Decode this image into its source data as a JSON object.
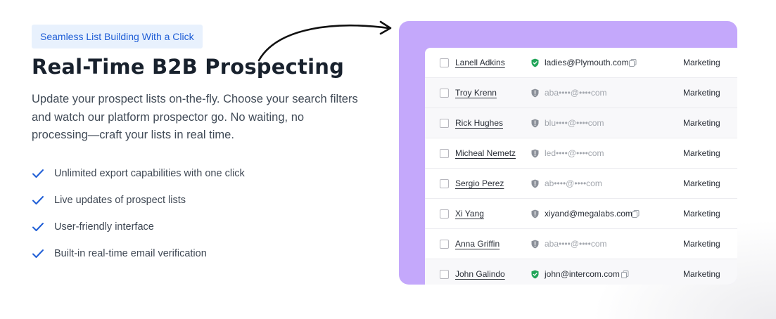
{
  "badge": "Seamless List Building With a Click",
  "headline": "Real-Time B2B Prospecting",
  "description": "Update your prospect lists on-the-fly. Choose your search filters and watch our platform prospector go. No waiting, no processing—craft your lists in real time.",
  "features": [
    "Unlimited export capabilities with one click",
    "Live updates of prospect lists",
    "User-friendly interface",
    "Built-in real-time email verification"
  ],
  "colors": {
    "accent": "#1f5ed6",
    "panel": "#c4a8fb",
    "verified": "#22a559",
    "unverified": "#8a8f98"
  },
  "prospects": [
    {
      "name": "Lanell Adkins",
      "email": "ladies@Plymouth.com",
      "verified": true,
      "department": "Marketing"
    },
    {
      "name": "Troy Krenn",
      "email": "aba••••@••••com",
      "verified": false,
      "department": "Marketing"
    },
    {
      "name": "Rick Hughes",
      "email": "blu••••@••••com",
      "verified": false,
      "department": "Marketing"
    },
    {
      "name": "Micheal Nemetz",
      "email": "led••••@••••com",
      "verified": false,
      "department": "Marketing"
    },
    {
      "name": "Sergio Perez",
      "email": "ab••••@••••com",
      "verified": false,
      "department": "Marketing"
    },
    {
      "name": "Xi Yang",
      "email": "xiyand@megalabs.com",
      "verified": false,
      "department": "Marketing"
    },
    {
      "name": "Anna Griffin",
      "email": "aba••••@••••com",
      "verified": false,
      "department": "Marketing"
    },
    {
      "name": "John Galindo",
      "email": "john@intercom.com",
      "verified": true,
      "department": "Marketing"
    }
  ]
}
